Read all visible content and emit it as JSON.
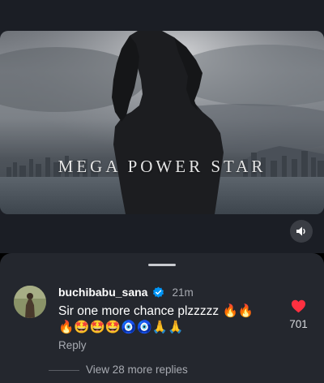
{
  "video": {
    "title": "MEGA POWER STAR",
    "mute_icon": "speaker-icon"
  },
  "comment": {
    "username": "buchibabu_sana",
    "verified_icon": "verified-badge-icon",
    "timestamp": "21m",
    "text": "Sir one more chance plzzzzz 🔥🔥\n🔥🤩🤩🤩🧿🧿🙏🙏",
    "reply_label": "Reply",
    "like_icon": "heart-icon",
    "like_count": "701",
    "like_color": "#ff3040"
  },
  "replies": {
    "label": "View 28 more replies"
  },
  "colors": {
    "sheet_bg": "#24272e",
    "top_bg": "#1b1e25",
    "verified_blue": "#0095f6",
    "muted_text": "#a8abb2"
  }
}
